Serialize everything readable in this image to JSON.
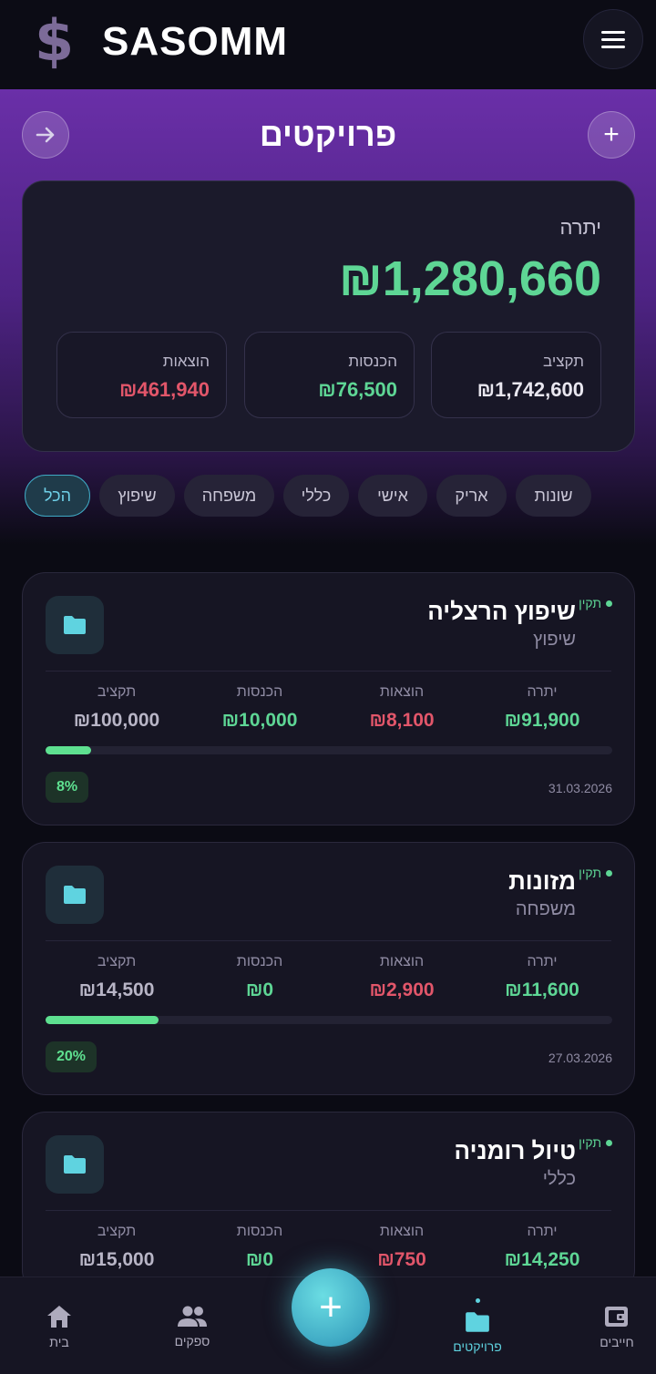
{
  "app": {
    "logo_symbol": "$",
    "brand": "SASOMM"
  },
  "header": {
    "title": "פרויקטים",
    "add_symbol": "+",
    "back_symbol": "→"
  },
  "summary": {
    "balance_label": "יתרה",
    "balance_value": "₪1,280,660",
    "budget_label": "תקציב",
    "budget_value": "₪1,742,600",
    "income_label": "הכנסות",
    "income_value": "₪76,500",
    "expenses_label": "הוצאות",
    "expenses_value": "₪461,940"
  },
  "filters": [
    "שונות",
    "אריק",
    "אישי",
    "כללי",
    "משפחה",
    "שיפוץ",
    "הכל"
  ],
  "filter_active": "הכל",
  "projects": [
    {
      "status": "תקין",
      "name": "שיפוץ הרצליה",
      "category": "שיפוץ",
      "balance_label": "יתרה",
      "balance": "₪91,900",
      "expenses_label": "הוצאות",
      "expenses": "₪8,100",
      "income_label": "הכנסות",
      "income": "₪10,000",
      "budget_label": "תקציב",
      "budget": "₪100,000",
      "percent": "8%",
      "progress": 0.08,
      "date": "31.03.2026"
    },
    {
      "status": "תקין",
      "name": "מזונות",
      "category": "משפחה",
      "balance_label": "יתרה",
      "balance": "₪11,600",
      "expenses_label": "הוצאות",
      "expenses": "₪2,900",
      "income_label": "הכנסות",
      "income": "₪0",
      "budget_label": "תקציב",
      "budget": "₪14,500",
      "percent": "20%",
      "progress": 0.2,
      "date": "27.03.2026"
    },
    {
      "status": "תקין",
      "name": "טיול רומניה",
      "category": "כללי",
      "balance_label": "יתרה",
      "balance": "₪14,250",
      "expenses_label": "הוצאות",
      "expenses": "₪750",
      "income_label": "הכנסות",
      "income": "₪0",
      "budget_label": "תקציב",
      "budget": "₪15,000"
    }
  ],
  "bottom_nav": {
    "home": "בית",
    "suppliers": "ספקים",
    "fab_symbol": "+",
    "projects": "פרויקטים",
    "debts": "חייבים",
    "active": "projects"
  },
  "colors": {
    "accent_green": "#5ed695",
    "accent_red": "#e2566a",
    "accent_cyan": "#5fd3e0",
    "hero_purple": "#6a2fa8"
  }
}
